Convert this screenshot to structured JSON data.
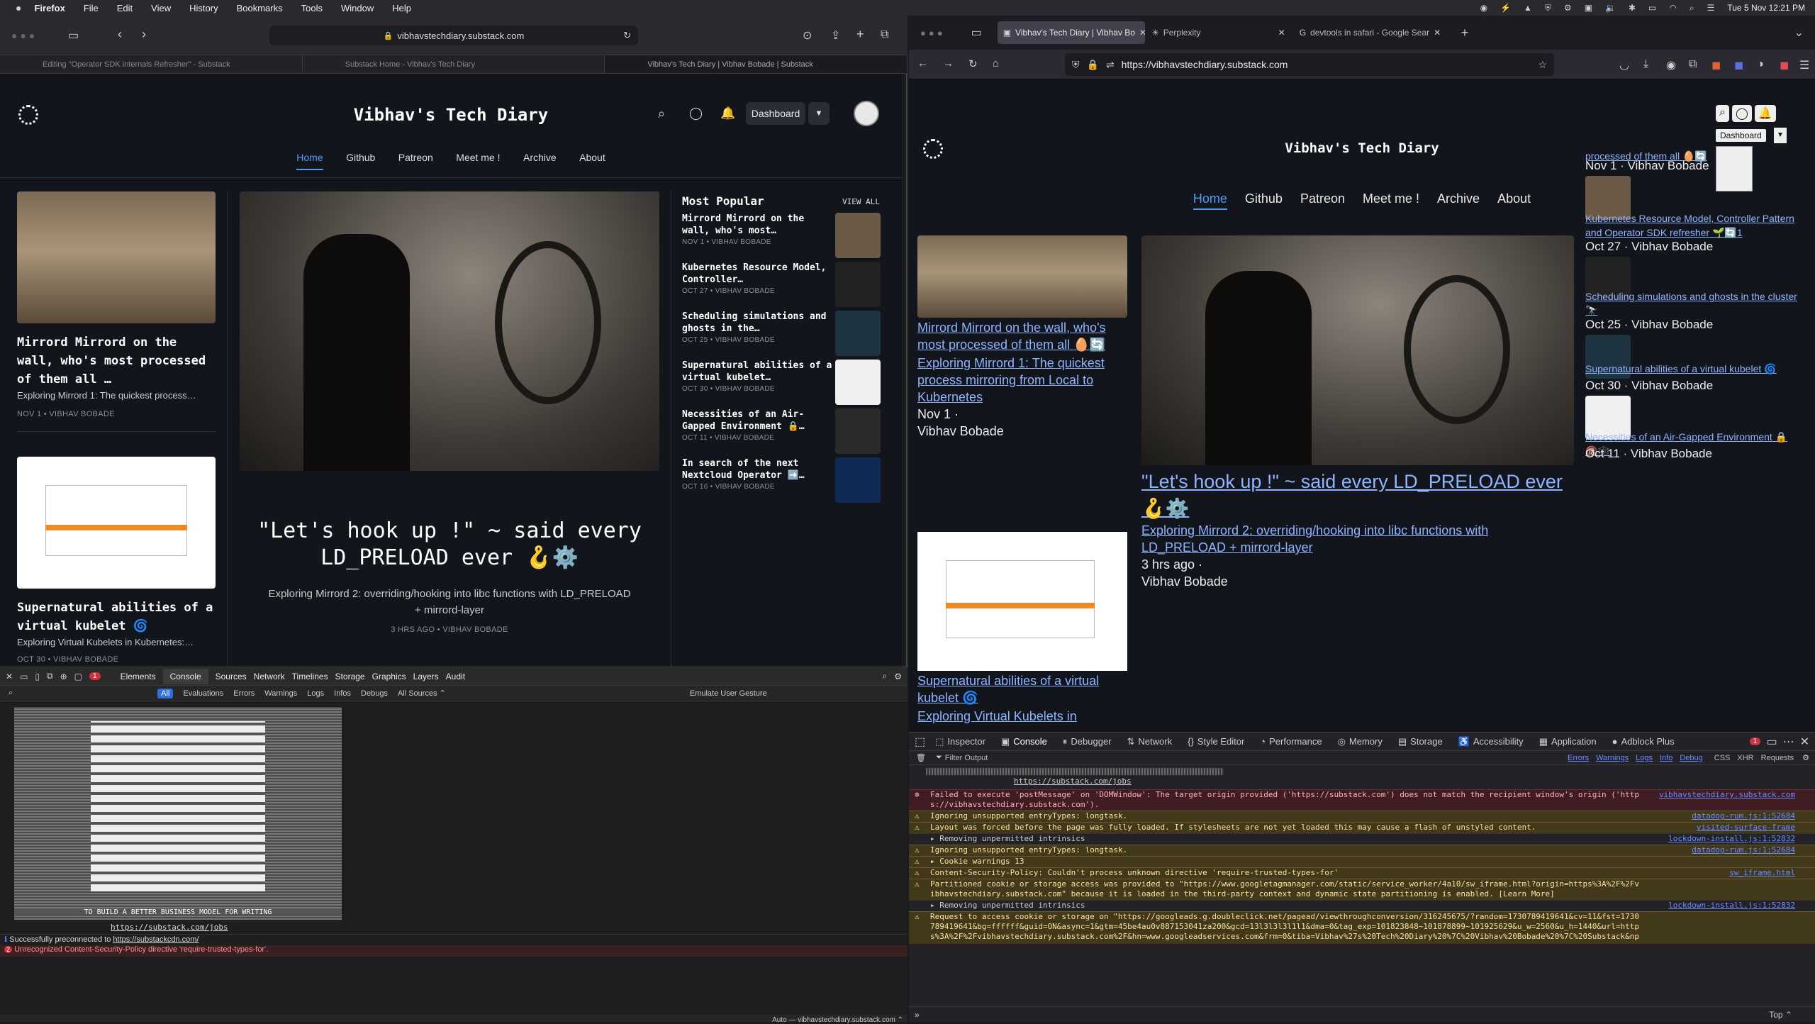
{
  "menubar": {
    "app": "Firefox",
    "items": [
      "File",
      "Edit",
      "View",
      "History",
      "Bookmarks",
      "Tools",
      "Window",
      "Help"
    ],
    "clock": "Tue 5 Nov  12:21 PM"
  },
  "left": {
    "address": "vibhavstechdiary.substack.com",
    "tabs": [
      "Editing \"Operator SDK internals Refresher\" - Substack",
      "Substack Home - Vibhav's Tech Diary",
      "Vibhav's Tech Diary | Vibhav Bobade | Substack"
    ],
    "site_title": "Vibhav's Tech Diary",
    "dashboard": "Dashboard",
    "nav": [
      "Home",
      "Github",
      "Patreon",
      "Meet me !",
      "Archive",
      "About"
    ],
    "card1": {
      "title": "Mirrord Mirrord on the wall, who's most processed of them all …",
      "sub": "Exploring Mirrord 1: The quickest process…",
      "meta": "NOV 1 • VIBHAV BOBADE"
    },
    "card2": {
      "title": "Supernatural abilities of a virtual kubelet 🌀",
      "sub": "Exploring Virtual Kubelets in Kubernetes:…",
      "meta": "OCT 30 • VIBHAV BOBADE"
    },
    "hero": {
      "title": "\"Let's hook up !\" ~ said every LD_PRELOAD ever 🪝⚙️",
      "sub": "Exploring Mirrord 2: overriding/hooking into libc functions with LD_PRELOAD + mirrord-layer",
      "meta": "3 HRS AGO • VIBHAV BOBADE"
    },
    "popular_heading": "Most Popular",
    "view_all": "VIEW ALL",
    "popular": [
      {
        "title": "Mirrord Mirrord on the wall, who's most…",
        "meta": "NOV 1 • VIBHAV BOBADE"
      },
      {
        "title": "Kubernetes Resource Model, Controller…",
        "meta": "OCT 27 • VIBHAV BOBADE"
      },
      {
        "title": "Scheduling simulations and ghosts in the…",
        "meta": "OCT 25 • VIBHAV BOBADE"
      },
      {
        "title": "Supernatural abilities of a virtual kubelet…",
        "meta": "OCT 30 • VIBHAV BOBADE"
      },
      {
        "title": "Necessities of an Air-Gapped Environment 🔒…",
        "meta": "OCT 11 • VIBHAV BOBADE"
      },
      {
        "title": "In search of the next Nextcloud Operator ➡️…",
        "meta": "OCT 16 • VIBHAV BOBADE"
      }
    ],
    "devtools": {
      "tabs": [
        "Elements",
        "Console",
        "Sources",
        "Network",
        "Timelines",
        "Storage",
        "Graphics",
        "Layers",
        "Audit"
      ],
      "filters": [
        "All",
        "Evaluations",
        "Errors",
        "Warnings",
        "Logs",
        "Infos",
        "Debugs"
      ],
      "all_sources": "All Sources ⌃",
      "emulate": "Emulate User Gesture",
      "ascii_caption": "TO BUILD A BETTER BUSINESS MODEL FOR WRITING",
      "jobs_link": "https://substack.com/jobs",
      "msg1_prefix": "Successfully preconnected to ",
      "msg1_link": "https://substackcdn.com/",
      "msg2": "Unrecognized Content-Security-Policy directive 'require-trusted-types-for'.",
      "msg2_count": "2",
      "error_count": "1",
      "context": "Auto — vibhavstechdiary.substack.com ⌃"
    }
  },
  "right": {
    "tabs": [
      "Vibhav's Tech Diary | Vibhav Bo",
      "Perplexity",
      "devtools in safari - Google Sear"
    ],
    "url": "https://vibhavstechdiary.substack.com",
    "site_title": "Vibhav's Tech Diary",
    "dashboard": "Dashboard",
    "nav": [
      "Home",
      "Github",
      "Patreon",
      "Meet me !",
      "Archive",
      "About"
    ],
    "left_col": {
      "title1": "Mirrord Mirrord on the wall, who's most processed of them all 🥚🔄",
      "sub1": "Exploring Mirrord 1: The quickest process mirroring from Local to Kubernetes",
      "date1": "Nov 1 ·",
      "author1": "Vibhav Bobade",
      "title2": "Supernatural abilities of a virtual kubelet 🌀",
      "sub2": "Exploring Virtual Kubelets in"
    },
    "hero": {
      "title": "\"Let's hook up !\" ~ said every LD_PRELOAD ever 🪝⚙️",
      "sub": "Exploring Mirrord 2: overriding/hooking into libc functions with LD_PRELOAD + mirrord-layer",
      "date": "3 hrs ago ·",
      "author": "Vibhav Bobade"
    },
    "right_col": [
      {
        "title": "processed of them all 🥚🔄",
        "meta": "Nov 1 · Vibhav Bobade"
      },
      {
        "title": "Kubernetes Resource Model, Controller Pattern and Operator SDK refresher 🌱🔄1",
        "meta": "Oct 27 · Vibhav Bobade"
      },
      {
        "title": "Scheduling simulations and ghosts in the cluster 🔭",
        "meta": "Oct 25 · Vibhav Bobade"
      },
      {
        "title": "Supernatural abilities of a virtual kubelet 🌀",
        "meta": "Oct 30 · Vibhav Bobade"
      },
      {
        "title": "Necessities of an Air-Gapped Environment 🔒🔞🕸️",
        "meta": "Oct 11 · Vibhav Bobade"
      }
    ],
    "devtools": {
      "tabs": [
        "Inspector",
        "Console",
        "Debugger",
        "Network",
        "Style Editor",
        "Performance",
        "Memory",
        "Storage",
        "Accessibility",
        "Application",
        "Adblock Plus"
      ],
      "filter": "Filter Output",
      "levels": [
        "Errors",
        "Warnings",
        "Logs",
        "Info",
        "Debug"
      ],
      "extras": [
        "CSS",
        "XHR",
        "Requests"
      ],
      "error_badge": "1",
      "jobs_link": "https://substack.com/jobs",
      "rows": [
        {
          "type": "err",
          "text": "Failed to execute 'postMessage' on 'DOMWindow': The target origin provided ('https://substack.com') does not match the recipient window's origin ('https://vibhavstechdiary.substack.com').",
          "src": "vibhavstechdiary.substack.com"
        },
        {
          "type": "warn",
          "text": "Ignoring unsupported entryTypes: longtask.",
          "src": "datadog-rum.js:1:52684"
        },
        {
          "type": "warn",
          "text": "Layout was forced before the page was fully loaded. If stylesheets are not yet loaded this may cause a flash of unstyled content.",
          "src": "visited-surface-frame"
        },
        {
          "type": "info",
          "text": "▸ Removing unpermitted intrinsics",
          "src": "lockdown-install.js:1:52832"
        },
        {
          "type": "warn",
          "text": "Ignoring unsupported entryTypes: longtask.",
          "src": "datadog-rum.js:1:52684"
        },
        {
          "type": "warn",
          "text": "▸ Cookie warnings  13",
          "src": ""
        },
        {
          "type": "warn",
          "text": "Content-Security-Policy: Couldn't process unknown directive 'require-trusted-types-for'",
          "src": "sw_iframe.html"
        },
        {
          "type": "warn",
          "text": "Partitioned cookie or storage access was provided to \"https://www.googletagmanager.com/static/service_worker/4a10/sw_iframe.html?origin=https%3A%2F%2Fvibhavstechdiary.substack.com\" because it is loaded in the third-party context and dynamic state partitioning is enabled. [Learn More]",
          "src": ""
        },
        {
          "type": "info",
          "text": "▸ Removing unpermitted intrinsics",
          "src": "lockdown-install.js:1:52832"
        },
        {
          "type": "warn",
          "text": "Request to access cookie or storage on \"https://googleads.g.doubleclick.net/pagead/viewthroughconversion/316245675/?random=1730789419641&cv=11&fst=1730789419641&bg=ffffff&guid=ON&async=1&gtm=45be4au0v887153041za200&gcd=13l3l3l3l1l1&dma=0&tag_exp=101823848~101878899~101925629&u_w=2560&u_h=1440&url=https%3A%2F%2Fvibhavstechdiary.substack.com%2F&hn=www.googleadservices.com&frm=0&tiba=Vibhav%27s%20Tech%20Diary%20%7C%20Vibhav%20Bobade%20%7C%20Substack&npa=0&pscdl=noapi&auid=1521624169.1727874911&fledge=1&data=event%3Dgtag.config&rfmt=3&fmt=4\" was blocked because it came from a tracker and content blocking is enabled. [Learn More]",
          "src": ""
        }
      ],
      "footer": "Top ⌃"
    }
  }
}
